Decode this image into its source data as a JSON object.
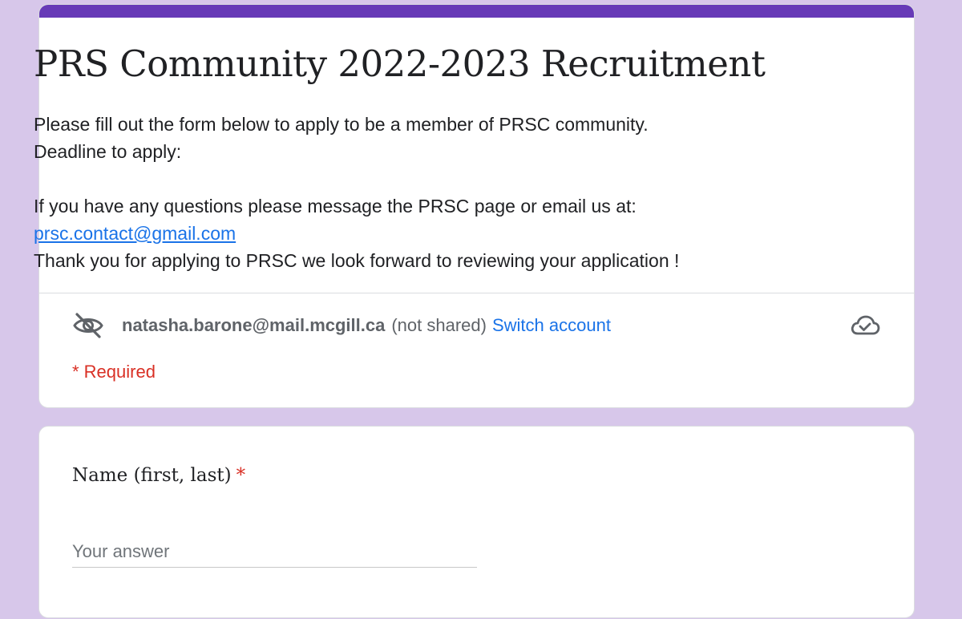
{
  "form": {
    "accent_color": "#673ab7",
    "title": "PRS Community 2022-2023 Recruitment",
    "description": {
      "line1": "Please fill out the form below to apply to be a member of PRSC community.",
      "line2": "Deadline to apply:",
      "line3": "",
      "line4": "If you have any questions please message the PRSC page or email us at:",
      "email_link": "prsc.contact@gmail.com",
      "line6": "Thank you for applying to PRSC we look forward to reviewing your application !"
    },
    "account": {
      "email": "natasha.barone@mail.mcgill.ca",
      "not_shared": "(not shared)",
      "switch_label": "Switch account",
      "visibility_icon": "eye-off-icon",
      "save_icon": "cloud-check-icon"
    },
    "required_note": "* Required"
  },
  "question": {
    "label": "Name (first, last)",
    "required_marker": "*",
    "placeholder": "Your answer",
    "value": ""
  },
  "colors": {
    "background": "#d7c7ea",
    "link": "#1a73e8",
    "required": "#d93025"
  }
}
